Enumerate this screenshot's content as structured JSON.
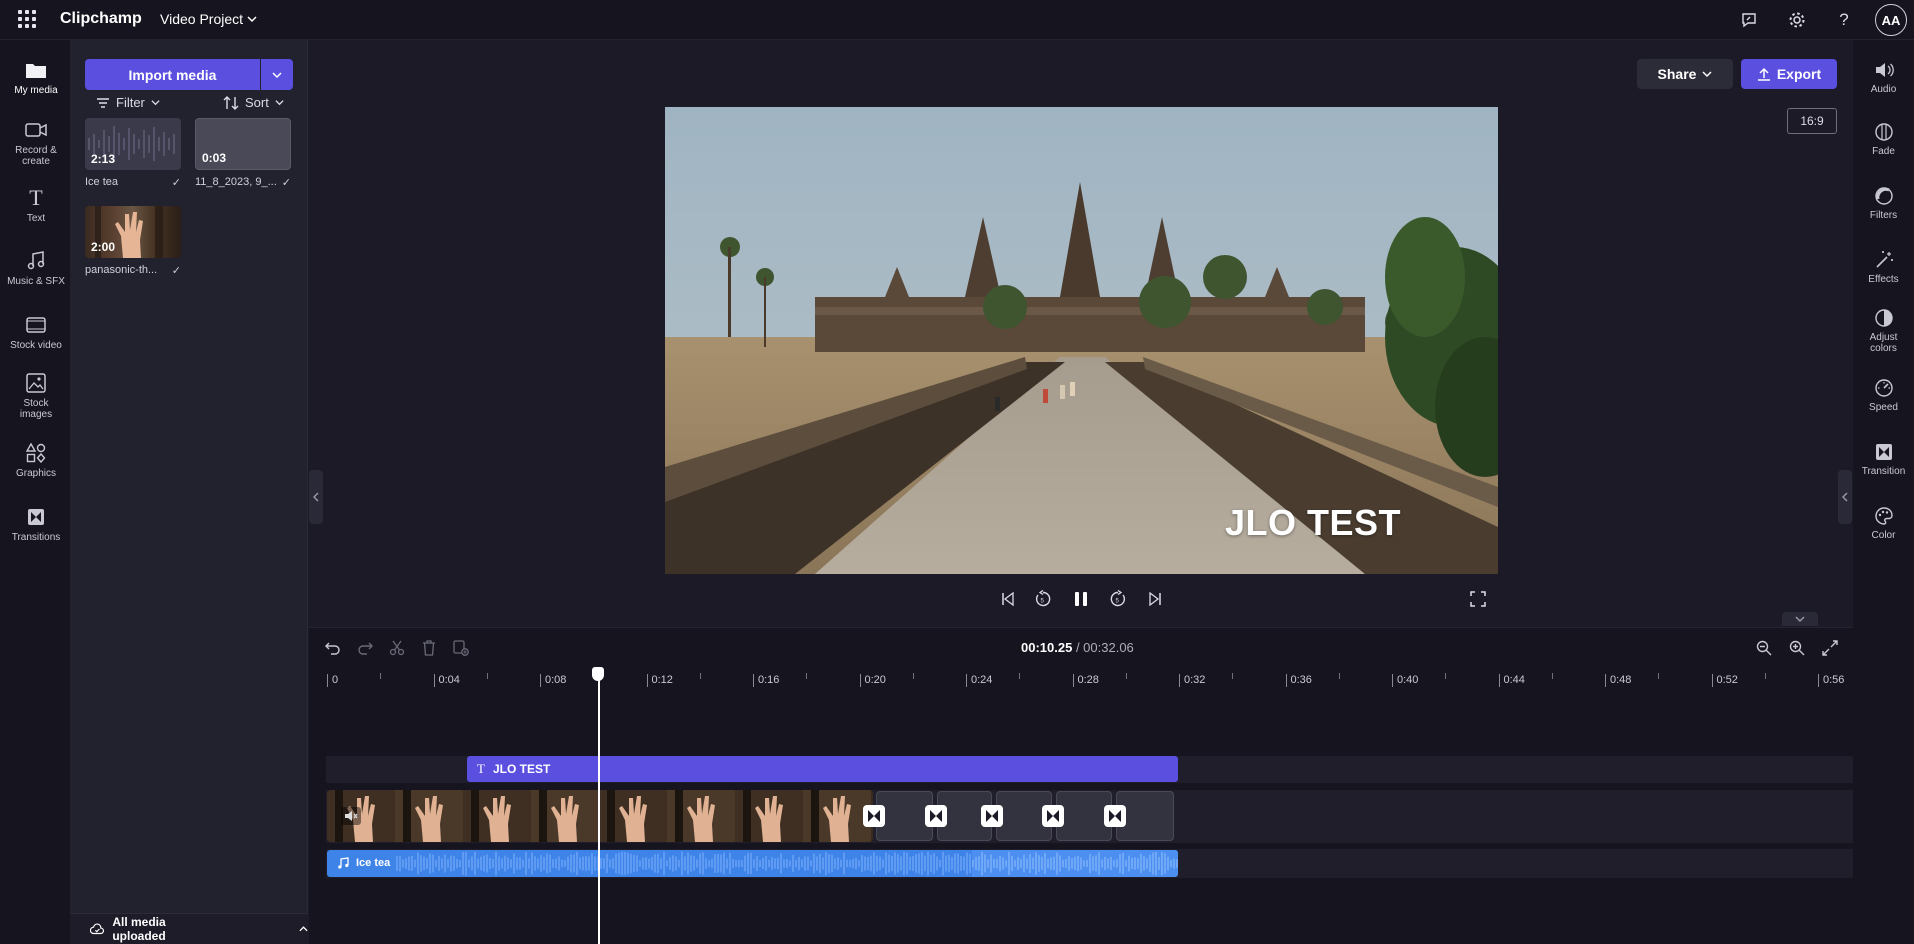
{
  "app": {
    "brand": "Clipchamp",
    "project_title": "Video Project",
    "avatar_initials": "AA"
  },
  "left_rail": [
    {
      "label": "My media",
      "icon": "folder-icon",
      "active": true
    },
    {
      "label": "Record & create",
      "icon": "camera-icon"
    },
    {
      "label": "Text",
      "icon": "text-icon"
    },
    {
      "label": "Music & SFX",
      "icon": "music-icon"
    },
    {
      "label": "Stock video",
      "icon": "film-icon"
    },
    {
      "label": "Stock images",
      "icon": "image-icon"
    },
    {
      "label": "Graphics",
      "icon": "shapes-icon"
    },
    {
      "label": "Transitions",
      "icon": "transition-icon"
    }
  ],
  "media": {
    "import_label": "Import media",
    "filter_label": "Filter",
    "sort_label": "Sort",
    "items": [
      {
        "name": "Ice tea",
        "duration": "2:13",
        "kind": "audio"
      },
      {
        "name": "11_8_2023, 9_...",
        "duration": "0:03",
        "kind": "video-blank"
      },
      {
        "name": "panasonic-th...",
        "duration": "2:00",
        "kind": "video"
      }
    ],
    "status": "All media uploaded"
  },
  "preview": {
    "share_label": "Share",
    "export_label": "Export",
    "aspect_ratio": "16:9",
    "overlay_text": "JLO TEST"
  },
  "timeline": {
    "current_time": "00:10.25",
    "total_time": "/ 00:32.06",
    "ticks": [
      "0",
      "0:04",
      "0:08",
      "0:12",
      "0:16",
      "0:20",
      "0:24",
      "0:28",
      "0:32",
      "0:36",
      "0:40",
      "0:44",
      "0:48",
      "0:52",
      "0:56"
    ],
    "text_clip_label": "JLO TEST",
    "audio_clip_label": "Ice tea"
  },
  "right_rail": [
    {
      "label": "Audio",
      "icon": "speaker-icon"
    },
    {
      "label": "Fade",
      "icon": "fade-icon"
    },
    {
      "label": "Filters",
      "icon": "filters-icon"
    },
    {
      "label": "Effects",
      "icon": "wand-icon"
    },
    {
      "label": "Adjust colors",
      "icon": "contrast-icon"
    },
    {
      "label": "Speed",
      "icon": "speed-icon"
    },
    {
      "label": "Transition",
      "icon": "transition-icon"
    },
    {
      "label": "Color",
      "icon": "palette-icon"
    }
  ],
  "colors": {
    "accent": "#5b4fe0",
    "audio": "#3e83e8",
    "background": "#1b1a26"
  }
}
